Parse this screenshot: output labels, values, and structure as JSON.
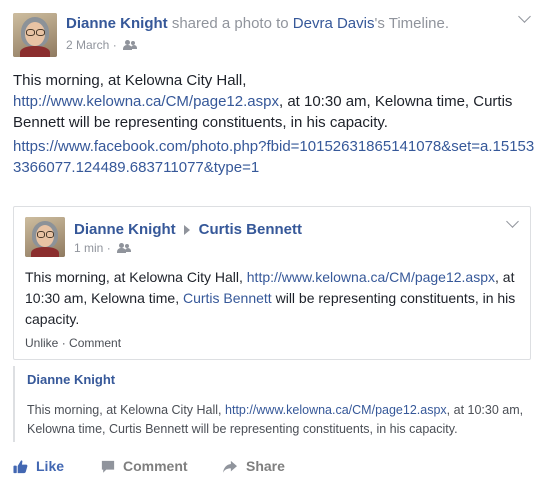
{
  "post": {
    "author": "Dianne Knight",
    "shared_text": "shared a photo to",
    "target": "Devra Davis",
    "target_suffix": "'s Timeline.",
    "date": "2 March",
    "date_sep": "·",
    "message_line1": "This morning, at Kelowna City Hall,",
    "message_link": "http://www.kelowna.ca/CM/page12.aspx",
    "message_rest": ", at 10:30 am, Kelowna time, Curtis Bennett will be representing constituents, in his capacity.",
    "photo_url": "https://www.facebook.com/photo.php?fbid=10152631865141078&set=a.151533366077.124489.683711077&type=1"
  },
  "embed": {
    "author": "Dianne Knight",
    "recipient": "Curtis Bennett",
    "time": "1 min",
    "time_sep": "·",
    "text_start": "This morning, at Kelowna City Hall,",
    "link": "http://www.kelowna.ca/CM/page12.aspx",
    "text_mid": ", at 10:30 am, Kelowna time,",
    "mention": "Curtis Bennett",
    "text_end": "will be representing constituents, in his capacity.",
    "unlike_label": "Unlike",
    "action_sep": "·",
    "comment_label": "Comment"
  },
  "quote": {
    "author": "Dianne Knight",
    "text_start": "This morning, at Kelowna City Hall,",
    "link": "http://www.kelowna.ca/CM/page12.aspx",
    "text_end": ", at 10:30 am, Kelowna time, Curtis Bennett will be representing constituents, in his capacity."
  },
  "actions": {
    "like_label": "Like",
    "comment_label": "Comment",
    "share_label": "Share"
  },
  "colors": {
    "link": "#365899",
    "like_blue": "#4267b2",
    "muted": "#90949c",
    "border": "#dddfe2"
  },
  "icons": [
    "thumbs-up-icon",
    "comment-icon",
    "share-icon",
    "audience-friends-icon",
    "chevron-down-icon"
  ]
}
